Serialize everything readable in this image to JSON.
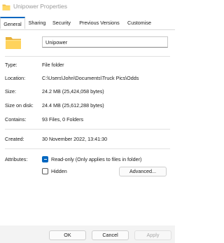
{
  "window": {
    "title": "Unipower Properties"
  },
  "tabs": [
    {
      "label": "General",
      "active": true
    },
    {
      "label": "Sharing",
      "active": false
    },
    {
      "label": "Security",
      "active": false
    },
    {
      "label": "Previous Versions",
      "active": false
    },
    {
      "label": "Customise",
      "active": false
    }
  ],
  "name_field": {
    "value": "Unipower"
  },
  "properties": {
    "type": {
      "label": "Type:",
      "value": "File folder"
    },
    "location": {
      "label": "Location:",
      "value": "C:\\Users\\John\\Documents\\Truck Pics\\Odds"
    },
    "size": {
      "label": "Size:",
      "value": "24.2 MB (25,424,058 bytes)"
    },
    "size_on_disk": {
      "label": "Size on disk:",
      "value": "24.4 MB (25,612,288 bytes)"
    },
    "contains": {
      "label": "Contains:",
      "value": "93 Files, 0 Folders"
    },
    "created": {
      "label": "Created:",
      "value": "30 November 2022, 13:41:30"
    }
  },
  "attributes": {
    "label": "Attributes:",
    "read_only": {
      "label": "Read-only (Only applies to files in folder)",
      "state": "indeterminate"
    },
    "hidden": {
      "label": "Hidden",
      "checked": false
    },
    "advanced_label": "Advanced..."
  },
  "footer": {
    "ok_label": "OK",
    "cancel_label": "Cancel",
    "apply_label": "Apply"
  },
  "colors": {
    "accent": "#0067c0",
    "title_text": "#9a9a9a",
    "disabled_text": "#a8a8a8"
  },
  "icons": {
    "title": "folder-icon",
    "main": "folder-icon"
  }
}
